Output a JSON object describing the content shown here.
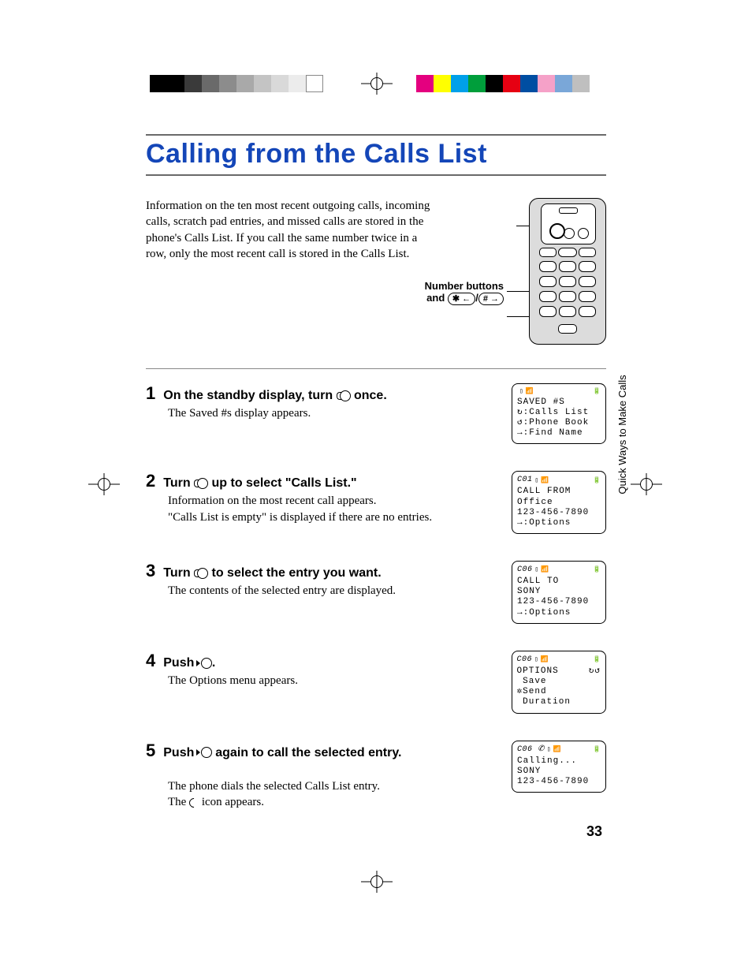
{
  "title": "Calling from the Calls List",
  "intro": "Information on the ten most recent outgoing calls, incoming calls, scratch pad entries, and missed calls are stored in the phone's Calls List. If you call the same number twice in a row, only the most recent call is stored in the Calls List.",
  "diagram": {
    "label_number_buttons": "Number buttons",
    "label_and": "and",
    "key_star": "✱ ←",
    "key_hash": "# →"
  },
  "side_tab": "Quick Ways\nto Make Calls",
  "steps": [
    {
      "num": "1",
      "title_pre": "On the standby display, turn ",
      "title_post": " once.",
      "body": "The Saved #s display appears.",
      "lcd": {
        "id": "",
        "lines": [
          "SAVED #S",
          "↻:Calls List",
          "↺:Phone Book",
          "→:Find Name"
        ]
      }
    },
    {
      "num": "2",
      "title_pre": "Turn ",
      "title_post": " up to select \"Calls List.\"",
      "body": "Information on the most recent call appears.\n\"Calls List is empty\" is displayed if there are no entries.",
      "lcd": {
        "id": "C01",
        "lines": [
          "CALL FROM",
          "Office",
          "123-456-7890",
          "→:Options"
        ]
      }
    },
    {
      "num": "3",
      "title_pre": "Turn ",
      "title_post": " to select the entry you want.",
      "body": "The contents of the selected entry are displayed.",
      "lcd": {
        "id": "C06",
        "lines": [
          "CALL TO",
          "SONY",
          "123-456-7890",
          "→:Options"
        ]
      }
    },
    {
      "num": "4",
      "title_pre": "Push ",
      "title_post": ".",
      "body": "The Options menu appears.",
      "lcd": {
        "id": "C06",
        "lines": [
          "OPTIONS     ↻↺",
          " Save",
          "✲Send",
          " Duration"
        ]
      }
    },
    {
      "num": "5",
      "title_pre": "Push ",
      "title_post": " again to call the selected entry.",
      "body_pre": "The phone dials the selected Calls List entry.\nThe ",
      "body_post": " icon appears.",
      "lcd": {
        "id": "C06 ✆",
        "lines": [
          "Calling...",
          "SONY",
          "",
          "123-456-7890"
        ]
      }
    }
  ],
  "page_number": "33"
}
